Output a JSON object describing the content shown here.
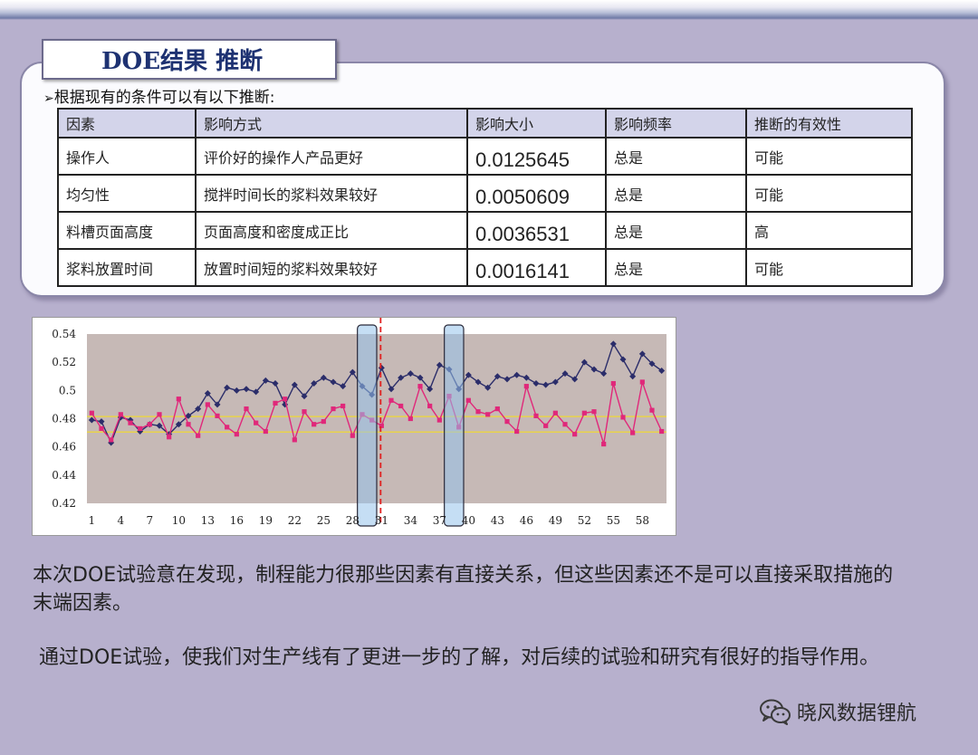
{
  "title": "DOE结果 推断",
  "lead": "根据现有的条件可以有以下推断:",
  "table": {
    "headers": [
      "因素",
      "影响方式",
      "影响大小",
      "影响频率",
      "推断的有效性"
    ],
    "rows": [
      [
        "操作人",
        "评价好的操作人产品更好",
        "0.0125645",
        "总是",
        "可能"
      ],
      [
        "均匀性",
        "搅拌时间长的浆料效果较好",
        "0.0050609",
        "总是",
        "可能"
      ],
      [
        "料槽页面高度",
        "页面高度和密度成正比",
        "0.0036531",
        "总是",
        "高"
      ],
      [
        "浆料放置时间",
        "放置时间短的浆料效果较好",
        "0.0016141",
        "总是",
        "可能"
      ]
    ]
  },
  "chart_data": {
    "type": "line",
    "x": [
      1,
      2,
      3,
      4,
      5,
      6,
      7,
      8,
      9,
      10,
      11,
      12,
      13,
      14,
      15,
      16,
      17,
      18,
      19,
      20,
      21,
      22,
      23,
      24,
      25,
      26,
      27,
      28,
      29,
      30,
      31,
      32,
      33,
      34,
      35,
      36,
      37,
      38,
      39,
      40,
      41,
      42,
      43,
      44,
      45,
      46,
      47,
      48,
      49,
      50,
      51,
      52,
      53,
      54,
      55,
      56,
      57,
      58,
      59,
      60
    ],
    "x_tick_labels": [
      "1",
      "4",
      "7",
      "10",
      "13",
      "16",
      "19",
      "22",
      "25",
      "28",
      "31",
      "34",
      "37",
      "40",
      "43",
      "46",
      "49",
      "52",
      "55",
      "58"
    ],
    "y_tick_labels": [
      "0.54",
      "0.52",
      "0.5",
      "0.48",
      "0.46",
      "0.44",
      "0.42"
    ],
    "ylim": [
      0.42,
      0.54
    ],
    "series": [
      {
        "color": "#2b2d6a",
        "marker": "diamond",
        "values": [
          0.479,
          0.478,
          0.463,
          0.481,
          0.479,
          0.471,
          0.476,
          0.475,
          0.469,
          0.476,
          0.482,
          0.487,
          0.498,
          0.49,
          0.502,
          0.5,
          0.501,
          0.499,
          0.507,
          0.505,
          0.49,
          0.504,
          0.496,
          0.505,
          0.509,
          0.506,
          0.503,
          0.513,
          0.503,
          0.497,
          0.516,
          0.501,
          0.509,
          0.512,
          0.509,
          0.501,
          0.518,
          0.515,
          0.501,
          0.511,
          0.506,
          0.502,
          0.51,
          0.508,
          0.511,
          0.509,
          0.505,
          0.504,
          0.506,
          0.512,
          0.508,
          0.52,
          0.515,
          0.512,
          0.533,
          0.522,
          0.51,
          0.526,
          0.519,
          0.514
        ]
      },
      {
        "color": "#e0287a",
        "marker": "square",
        "values": [
          0.484,
          0.473,
          0.465,
          0.483,
          0.477,
          0.473,
          0.476,
          0.483,
          0.467,
          0.494,
          0.476,
          0.468,
          0.49,
          0.482,
          0.474,
          0.469,
          0.487,
          0.477,
          0.471,
          0.491,
          0.494,
          0.465,
          0.485,
          0.476,
          0.478,
          0.487,
          0.489,
          0.468,
          0.483,
          0.479,
          0.475,
          0.493,
          0.489,
          0.48,
          0.503,
          0.489,
          0.479,
          0.496,
          0.474,
          0.493,
          0.485,
          0.483,
          0.487,
          0.478,
          0.471,
          0.503,
          0.482,
          0.475,
          0.484,
          0.476,
          0.469,
          0.484,
          0.485,
          0.462,
          0.505,
          0.481,
          0.47,
          0.506,
          0.486,
          0.471
        ]
      }
    ],
    "reference_lines": [
      {
        "y": 0.4815,
        "color": "#e8d34a"
      },
      {
        "y": 0.4705,
        "color": "#e8d34a"
      }
    ],
    "vertical_marker_x": 31,
    "highlight_ranges": [
      [
        28.5,
        30.5
      ],
      [
        37.5,
        39.5
      ]
    ],
    "grid": false
  },
  "paragraphs": [
    "本次DOE试验意在发现，制程能力很那些因素有直接关系，但这些因素还不是可以直接采取措施的末端因素。",
    "通过DOE试验，使我们对生产线有了更进一步的了解，对后续的试验和研究有很好的指导作用。"
  ],
  "watermark": {
    "icon": "wechat-icon",
    "text": "晓风数据锂航"
  }
}
